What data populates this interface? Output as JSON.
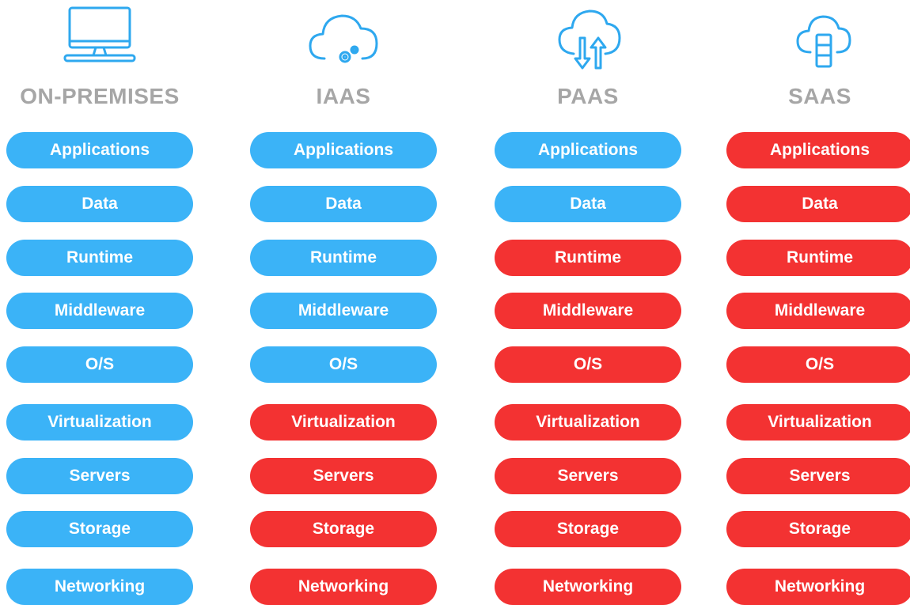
{
  "colors": {
    "managed_by_you": "#3bb3f7",
    "managed_by_vendor": "#f33232",
    "title": "#a6a6a6",
    "icon": "#2ea8ef"
  },
  "columns": [
    {
      "title": "ON-PREMISES",
      "icon": "monitor-icon",
      "layers": [
        {
          "label": "Applications",
          "status": "managed_by_you"
        },
        {
          "label": "Data",
          "status": "managed_by_you"
        },
        {
          "label": "Runtime",
          "status": "managed_by_you"
        },
        {
          "label": "Middleware",
          "status": "managed_by_you"
        },
        {
          "label": "O/S",
          "status": "managed_by_you"
        },
        {
          "label": "Virtualization",
          "status": "managed_by_you"
        },
        {
          "label": "Servers",
          "status": "managed_by_you"
        },
        {
          "label": "Storage",
          "status": "managed_by_you"
        },
        {
          "label": "Networking",
          "status": "managed_by_you"
        }
      ]
    },
    {
      "title": "IAAS",
      "icon": "cloud-gears-icon",
      "layers": [
        {
          "label": "Applications",
          "status": "managed_by_you"
        },
        {
          "label": "Data",
          "status": "managed_by_you"
        },
        {
          "label": "Runtime",
          "status": "managed_by_you"
        },
        {
          "label": "Middleware",
          "status": "managed_by_you"
        },
        {
          "label": "O/S",
          "status": "managed_by_you"
        },
        {
          "label": "Virtualization",
          "status": "managed_by_vendor"
        },
        {
          "label": "Servers",
          "status": "managed_by_vendor"
        },
        {
          "label": "Storage",
          "status": "managed_by_vendor"
        },
        {
          "label": "Networking",
          "status": "managed_by_vendor"
        }
      ]
    },
    {
      "title": "PAAS",
      "icon": "cloud-arrows-icon",
      "layers": [
        {
          "label": "Applications",
          "status": "managed_by_you"
        },
        {
          "label": "Data",
          "status": "managed_by_you"
        },
        {
          "label": "Runtime",
          "status": "managed_by_vendor"
        },
        {
          "label": "Middleware",
          "status": "managed_by_vendor"
        },
        {
          "label": "O/S",
          "status": "managed_by_vendor"
        },
        {
          "label": "Virtualization",
          "status": "managed_by_vendor"
        },
        {
          "label": "Servers",
          "status": "managed_by_vendor"
        },
        {
          "label": "Storage",
          "status": "managed_by_vendor"
        },
        {
          "label": "Networking",
          "status": "managed_by_vendor"
        }
      ]
    },
    {
      "title": "SAAS",
      "icon": "cloud-server-icon",
      "layers": [
        {
          "label": "Applications",
          "status": "managed_by_vendor"
        },
        {
          "label": "Data",
          "status": "managed_by_vendor"
        },
        {
          "label": "Runtime",
          "status": "managed_by_vendor"
        },
        {
          "label": "Middleware",
          "status": "managed_by_vendor"
        },
        {
          "label": "O/S",
          "status": "managed_by_vendor"
        },
        {
          "label": "Virtualization",
          "status": "managed_by_vendor"
        },
        {
          "label": "Servers",
          "status": "managed_by_vendor"
        },
        {
          "label": "Storage",
          "status": "managed_by_vendor"
        },
        {
          "label": "Networking",
          "status": "managed_by_vendor"
        }
      ]
    }
  ]
}
